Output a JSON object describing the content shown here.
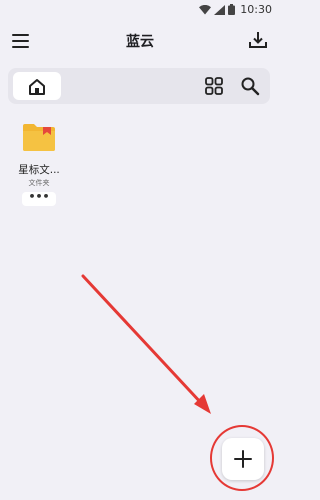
{
  "status_bar": {
    "time": "10:30"
  },
  "app_bar": {
    "title": "蓝云"
  },
  "files": [
    {
      "name": "星标文...",
      "type": "文件夹",
      "more": "•••"
    }
  ],
  "icons": {
    "menu": "menu-icon",
    "download": "download-icon",
    "home": "home-icon",
    "grid": "grid-view-icon",
    "search": "search-icon",
    "folder": "folder-icon",
    "add": "plus-icon"
  },
  "colors": {
    "background": "#f1f0f6",
    "folder": "#f2b632",
    "folder_tag": "#e5483c",
    "annotation": "#e53935"
  }
}
